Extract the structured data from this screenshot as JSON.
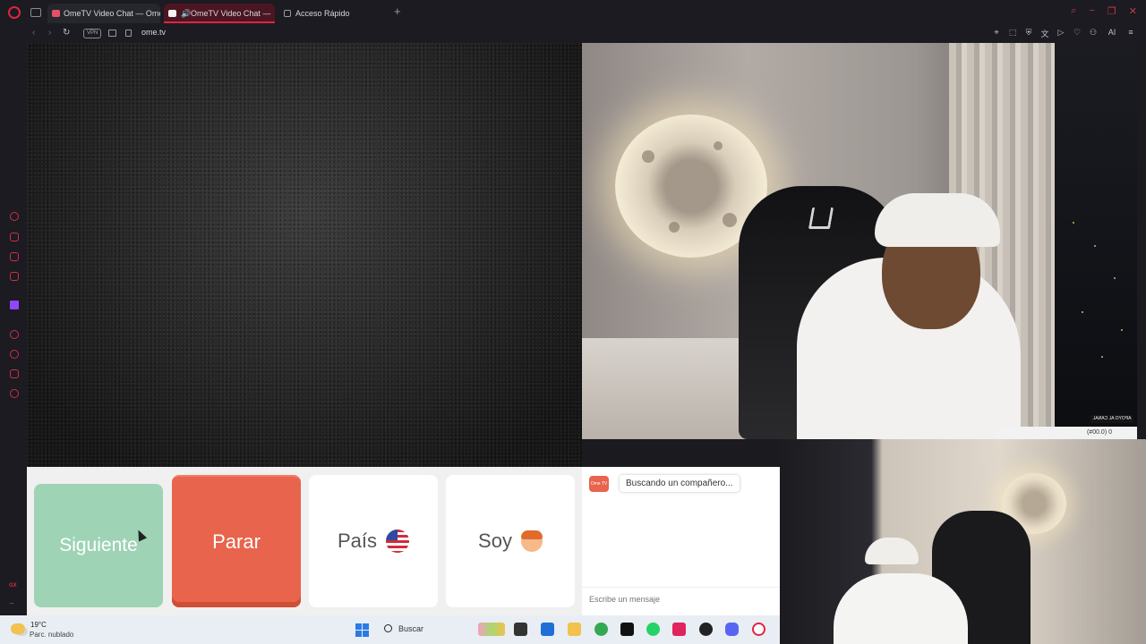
{
  "browser": {
    "tabs": [
      {
        "label": "OmeTV Video Chat — Ome",
        "active": false
      },
      {
        "label": "OmeTV Video Chat —",
        "active": true
      },
      {
        "label": "Acceso Rápido",
        "active": false
      }
    ],
    "new_tab_glyph": "+",
    "vpn_label": "VPN",
    "url": "ome.tv",
    "ai_label": "AI",
    "accent_color": "#e0243f"
  },
  "sidebar": {
    "gx_label": "GX",
    "icons": [
      "speed-dial-icon",
      "messenger-icon",
      "whatsapp-icon",
      "messenger-alt-icon",
      "twitch-icon",
      "player-icon",
      "history-icon",
      "pinboard-icon",
      "settings-icon"
    ]
  },
  "ometv": {
    "buttons": {
      "next": "Siguiente",
      "stop": "Parar",
      "country": "País",
      "gender": "Soy"
    },
    "country_flag": "us-flag-icon",
    "gender_icon": "boy-icon",
    "chat": {
      "logo_text": "Ome TV",
      "status_message": "Buscando un compañero...",
      "input_placeholder": "Escribe un mensaje"
    },
    "colors": {
      "next": "#9ed3b5",
      "stop": "#e8644c"
    }
  },
  "stream_overlay": {
    "tag": "APOYO AL CANAL",
    "badge": "(#00.0) 0"
  },
  "taskbar": {
    "temperature": "19°C",
    "weather": "Parc. nublado",
    "search_label": "Buscar"
  }
}
